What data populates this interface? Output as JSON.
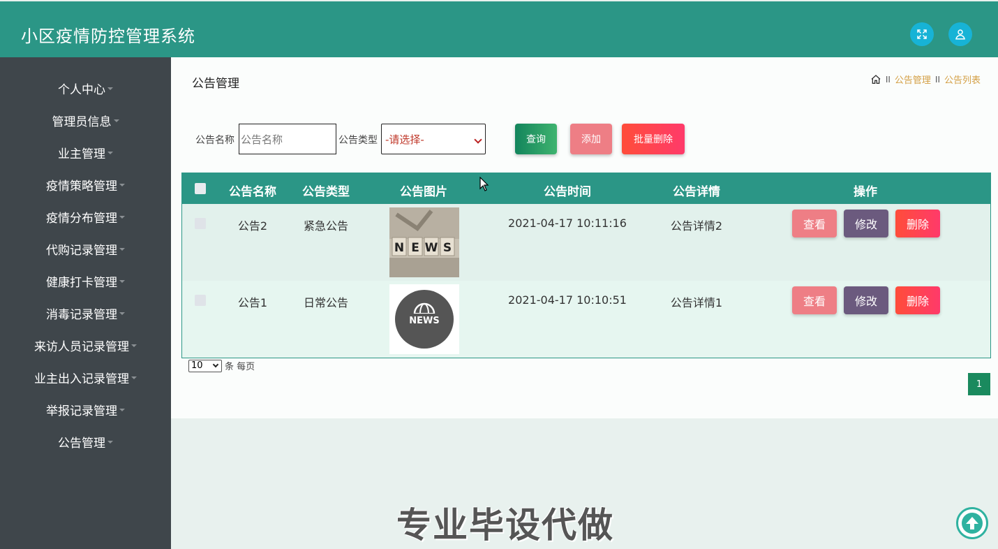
{
  "app": {
    "title": "小区疫情防控管理系统"
  },
  "colors": {
    "header": "#2b9686",
    "sidebar": "#3f464b",
    "accent": "#17b3d6",
    "breadcrumb": "#d4a046"
  },
  "header": {
    "fullscreen_icon": "expand-icon",
    "user_icon": "user-icon"
  },
  "sidebar": {
    "items": [
      {
        "label": "个人中心"
      },
      {
        "label": "管理员信息"
      },
      {
        "label": "业主管理"
      },
      {
        "label": "疫情策略管理"
      },
      {
        "label": "疫情分布管理"
      },
      {
        "label": "代购记录管理"
      },
      {
        "label": "健康打卡管理"
      },
      {
        "label": "消毒记录管理"
      },
      {
        "label": "来访人员记录管理"
      },
      {
        "label": "业主出入记录管理"
      },
      {
        "label": "举报记录管理"
      },
      {
        "label": "公告管理"
      }
    ]
  },
  "page": {
    "title": "公告管理"
  },
  "breadcrumb": {
    "home_icon": "home-icon",
    "separator": "II",
    "level1": "公告管理",
    "level2": "公告列表"
  },
  "search": {
    "name_label": "公告名称",
    "name_placeholder": "公告名称",
    "type_label": "公告类型",
    "type_selected": "-请选择-",
    "query_label": "查询",
    "add_label": "添加",
    "batch_delete_label": "批量删除"
  },
  "table": {
    "headers": [
      "公告名称",
      "公告类型",
      "公告图片",
      "公告时间",
      "公告详情",
      "操作"
    ],
    "rows": [
      {
        "name": "公告2",
        "type": "紧急公告",
        "image": "news-blocks-image",
        "time": "2021-04-17 10:11:16",
        "detail": "公告详情2"
      },
      {
        "name": "公告1",
        "type": "日常公告",
        "image": "news-globe-image",
        "time": "2021-04-17 10:10:51",
        "detail": "公告详情1"
      }
    ],
    "actions": {
      "view": "查看",
      "edit": "修改",
      "delete": "删除"
    }
  },
  "pagination": {
    "page_size": "10",
    "per_page_text": "条 每页",
    "current_page": "1"
  },
  "watermark": "专业毕设代做"
}
